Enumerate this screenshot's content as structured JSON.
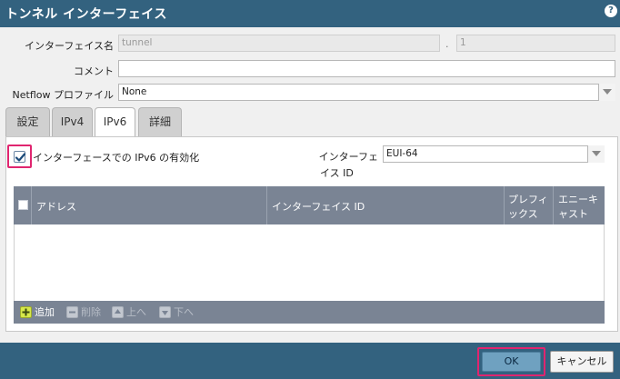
{
  "window": {
    "title": "トンネル インターフェイス",
    "help_icon": "?"
  },
  "form": {
    "interface_name_label": "インターフェイス名",
    "interface_name_value": "tunnel",
    "separator": ".",
    "subinterface_value": "1",
    "comment_label": "コメント",
    "comment_value": "",
    "netflow_label": "Netflow プロファイル",
    "netflow_value": "None"
  },
  "tabs": [
    {
      "label": "設定",
      "active": false
    },
    {
      "label": "IPv4",
      "active": false
    },
    {
      "label": "IPv6",
      "active": true
    },
    {
      "label": "詳細",
      "active": false
    }
  ],
  "ipv6": {
    "enable_label": "インターフェースでの IPv6 の有効化",
    "enable_checked": true,
    "interface_id_label_line1": "インターフェ",
    "interface_id_label_line2": "イス ID",
    "interface_id_value": "EUI-64"
  },
  "table": {
    "columns": [
      {
        "label": "アドレス"
      },
      {
        "label": "インターフェイス ID"
      },
      {
        "label_line1": "プレフィ",
        "label_line2": "ックス"
      },
      {
        "label_line1": "エニーキ",
        "label_line2": "ャスト"
      }
    ],
    "rows": []
  },
  "toolbar": {
    "add_label": "追加",
    "delete_label": "削除",
    "up_label": "上へ",
    "down_label": "下へ"
  },
  "buttons": {
    "ok_label": "OK",
    "cancel_label": "キャンセル"
  },
  "colors": {
    "titlebar": "#33627f",
    "highlight": "#e0256f",
    "grid_header": "#7a8494",
    "add_icon": "#d7e84a"
  }
}
